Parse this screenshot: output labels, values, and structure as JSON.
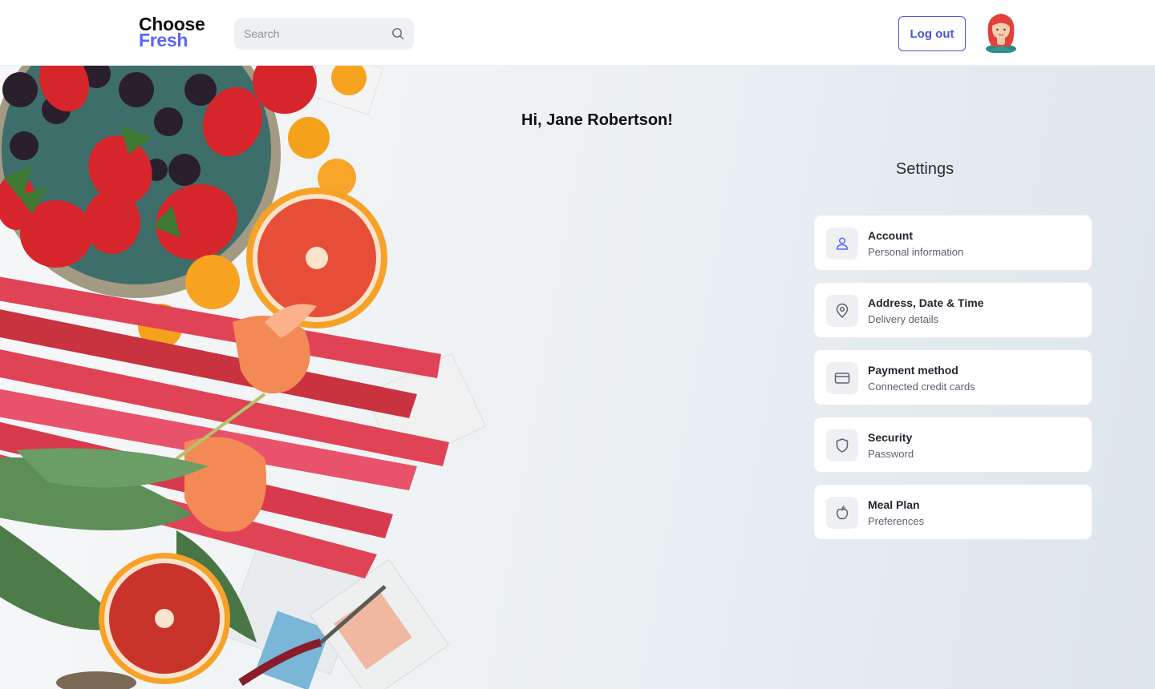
{
  "brand": {
    "line1": "Choose",
    "line2": "Fresh",
    "accent_color": "#5a67f2"
  },
  "search": {
    "placeholder": "Search",
    "value": "",
    "icon": "search-icon"
  },
  "header": {
    "logout_label": "Log out",
    "avatar": "user-avatar"
  },
  "greeting": "Hi, Jane Robertson!",
  "settings": {
    "title": "Settings",
    "items": [
      {
        "title": "Account",
        "subtitle": "Personal information",
        "icon": "user-icon"
      },
      {
        "title": "Address, Date & Time",
        "subtitle": "Delivery details",
        "icon": "location-pin-icon"
      },
      {
        "title": "Payment method",
        "subtitle": "Connected credit cards",
        "icon": "credit-card-icon"
      },
      {
        "title": "Security",
        "subtitle": "Password",
        "icon": "shield-icon"
      },
      {
        "title": "Meal Plan",
        "subtitle": "Preferences",
        "icon": "apple-icon"
      }
    ]
  }
}
